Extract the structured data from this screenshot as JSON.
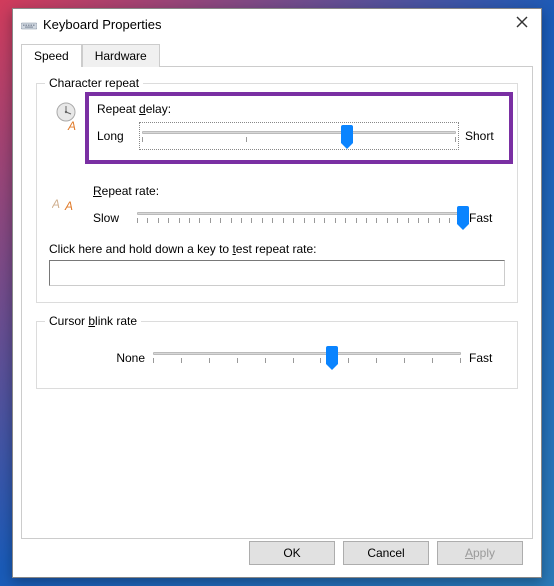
{
  "titlebar": {
    "title": "Keyboard Properties"
  },
  "tabs": {
    "speed": "Speed",
    "hardware": "Hardware"
  },
  "groups": {
    "charRepeat": {
      "title": "Character repeat"
    },
    "blink": {
      "title": "Cursor blink rate"
    }
  },
  "repeatDelay": {
    "label_pre": "Repeat ",
    "label_u": "d",
    "label_post": "elay:",
    "min": "Long",
    "max": "Short",
    "value_pct": 65
  },
  "repeatRate": {
    "label_u": "R",
    "label_post": "epeat rate:",
    "min": "Slow",
    "max": "Fast",
    "value_pct": 100
  },
  "testLabel": {
    "pre": "Click here and hold down a key to ",
    "u": "t",
    "post": "est repeat rate:"
  },
  "blinkRate": {
    "min": "None",
    "max": "Fast",
    "value_pct": 58
  },
  "buttons": {
    "ok": "OK",
    "cancel": "Cancel",
    "apply_u": "A",
    "apply_post": "pply"
  },
  "ticks": {
    "delay": 4,
    "rate": 32,
    "blink": 12
  }
}
